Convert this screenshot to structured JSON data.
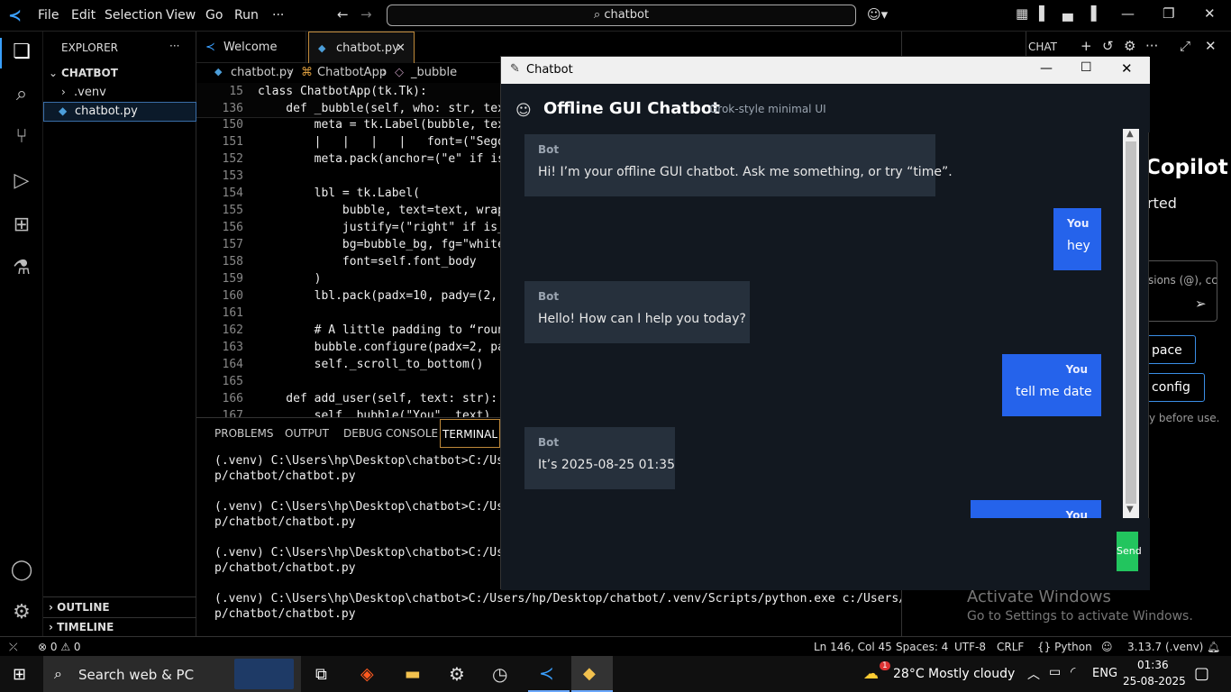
{
  "menubar": {
    "items": [
      "File",
      "Edit",
      "Selection",
      "View",
      "Go",
      "Run"
    ],
    "more": "···",
    "search": "chatbot"
  },
  "sidebar": {
    "title": "EXPLORER",
    "more": "···",
    "project": "CHATBOT",
    "items": [
      ".venv",
      "chatbot.py"
    ],
    "outline": "OUTLINE",
    "timeline": "TIMELINE"
  },
  "tabs": {
    "welcome": "Welcome",
    "file": "chatbot.py"
  },
  "breadcrumb": {
    "file": "chatbot.py",
    "cls": "ChatbotApp",
    "method": "_bubble"
  },
  "editor": {
    "sticky": [
      {
        "n": "15",
        "text": "class ChatbotApp(tk.Tk):"
      },
      {
        "n": "136",
        "text": "    def _bubble(self, who: str, text"
      }
    ],
    "lines": [
      {
        "n": "150",
        "text": "        meta = tk.Label(bubble, tex"
      },
      {
        "n": "151",
        "text": "        |   |   |   |   font=(\"Sego"
      },
      {
        "n": "152",
        "text": "        meta.pack(anchor=(\"e\" if is"
      },
      {
        "n": "153",
        "text": ""
      },
      {
        "n": "154",
        "text": "        lbl = tk.Label("
      },
      {
        "n": "155",
        "text": "            bubble, text=text, wrap"
      },
      {
        "n": "156",
        "text": "            justify=(\"right\" if is_"
      },
      {
        "n": "157",
        "text": "            bg=bubble_bg, fg=\"white"
      },
      {
        "n": "158",
        "text": "            font=self.font_body"
      },
      {
        "n": "159",
        "text": "        )"
      },
      {
        "n": "160",
        "text": "        lbl.pack(padx=10, pady=(2,"
      },
      {
        "n": "161",
        "text": ""
      },
      {
        "n": "162",
        "text": "        # A little padding to “roun"
      },
      {
        "n": "163",
        "text": "        bubble.configure(padx=2, pa"
      },
      {
        "n": "164",
        "text": "        self._scroll_to_bottom()"
      },
      {
        "n": "165",
        "text": ""
      },
      {
        "n": "166",
        "text": "    def add_user(self, text: str):"
      },
      {
        "n": "167",
        "text": "        self._bubble(\"You\", text)"
      }
    ]
  },
  "panel": {
    "tabs": [
      "PROBLEMS",
      "OUTPUT",
      "DEBUG CONSOLE",
      "TERMINAL"
    ],
    "terminal": [
      "(.venv) C:\\Users\\hp\\Desktop\\chatbot>C:/Users/h",
      "p/chatbot/chatbot.py",
      "",
      "(.venv) C:\\Users\\hp\\Desktop\\chatbot>C:/Users/h",
      "p/chatbot/chatbot.py",
      "",
      "(.venv) C:\\Users\\hp\\Desktop\\chatbot>C:/Users/h",
      "p/chatbot/chatbot.py",
      "",
      "(.venv) C:\\Users\\hp\\Desktop\\chatbot>C:/Users/hp/Desktop/chatbot/.venv/Scripts/python.exe c:/Users/hp/Deskto",
      "p/chatbot/chatbot.py"
    ]
  },
  "chat_panel": {
    "title": "CHAT",
    "copilot": "Copilot",
    "started": "rted",
    "input_placeholder": "sions (@), cc",
    "btn1": "pace",
    "btn2": "config",
    "note": "y before use.",
    "activate_title": "Activate Windows",
    "activate_sub": "Go to Settings to activate Windows."
  },
  "statusbar": {
    "errors": "0",
    "warnings": "0",
    "position": "Ln 146, Col 45",
    "spaces": "Spaces: 4",
    "encoding": "UTF-8",
    "eol": "CRLF",
    "language": "Python",
    "interpreter": "3.13.7 (.venv)"
  },
  "chatbot": {
    "window_title": "Chatbot",
    "heading": "Offline GUI Chatbot",
    "subheading": "Grok-style minimal UI",
    "messages": [
      {
        "who": "Bot",
        "text": "Hi! I’m your offline GUI chatbot. Ask me something, or try “time”."
      },
      {
        "who": "You",
        "text": "hey"
      },
      {
        "who": "Bot",
        "text": "Hello! How can I help you today?"
      },
      {
        "who": "You",
        "text": "tell me date"
      },
      {
        "who": "Bot",
        "text": "It’s 2025-08-25 01:35"
      },
      {
        "who": "You",
        "text": ""
      }
    ],
    "send": "Send"
  },
  "taskbar": {
    "search_placeholder": "Search web & PC",
    "weather": "28°C  Mostly cloudy",
    "weather_badge": "1",
    "lang": "ENG",
    "time": "01:36",
    "date": "25-08-2025"
  },
  "colors": {
    "accent_blue": "#2563eb",
    "send_green": "#22c55e",
    "bot_bubble": "#26303c",
    "chat_bg": "#121820"
  }
}
